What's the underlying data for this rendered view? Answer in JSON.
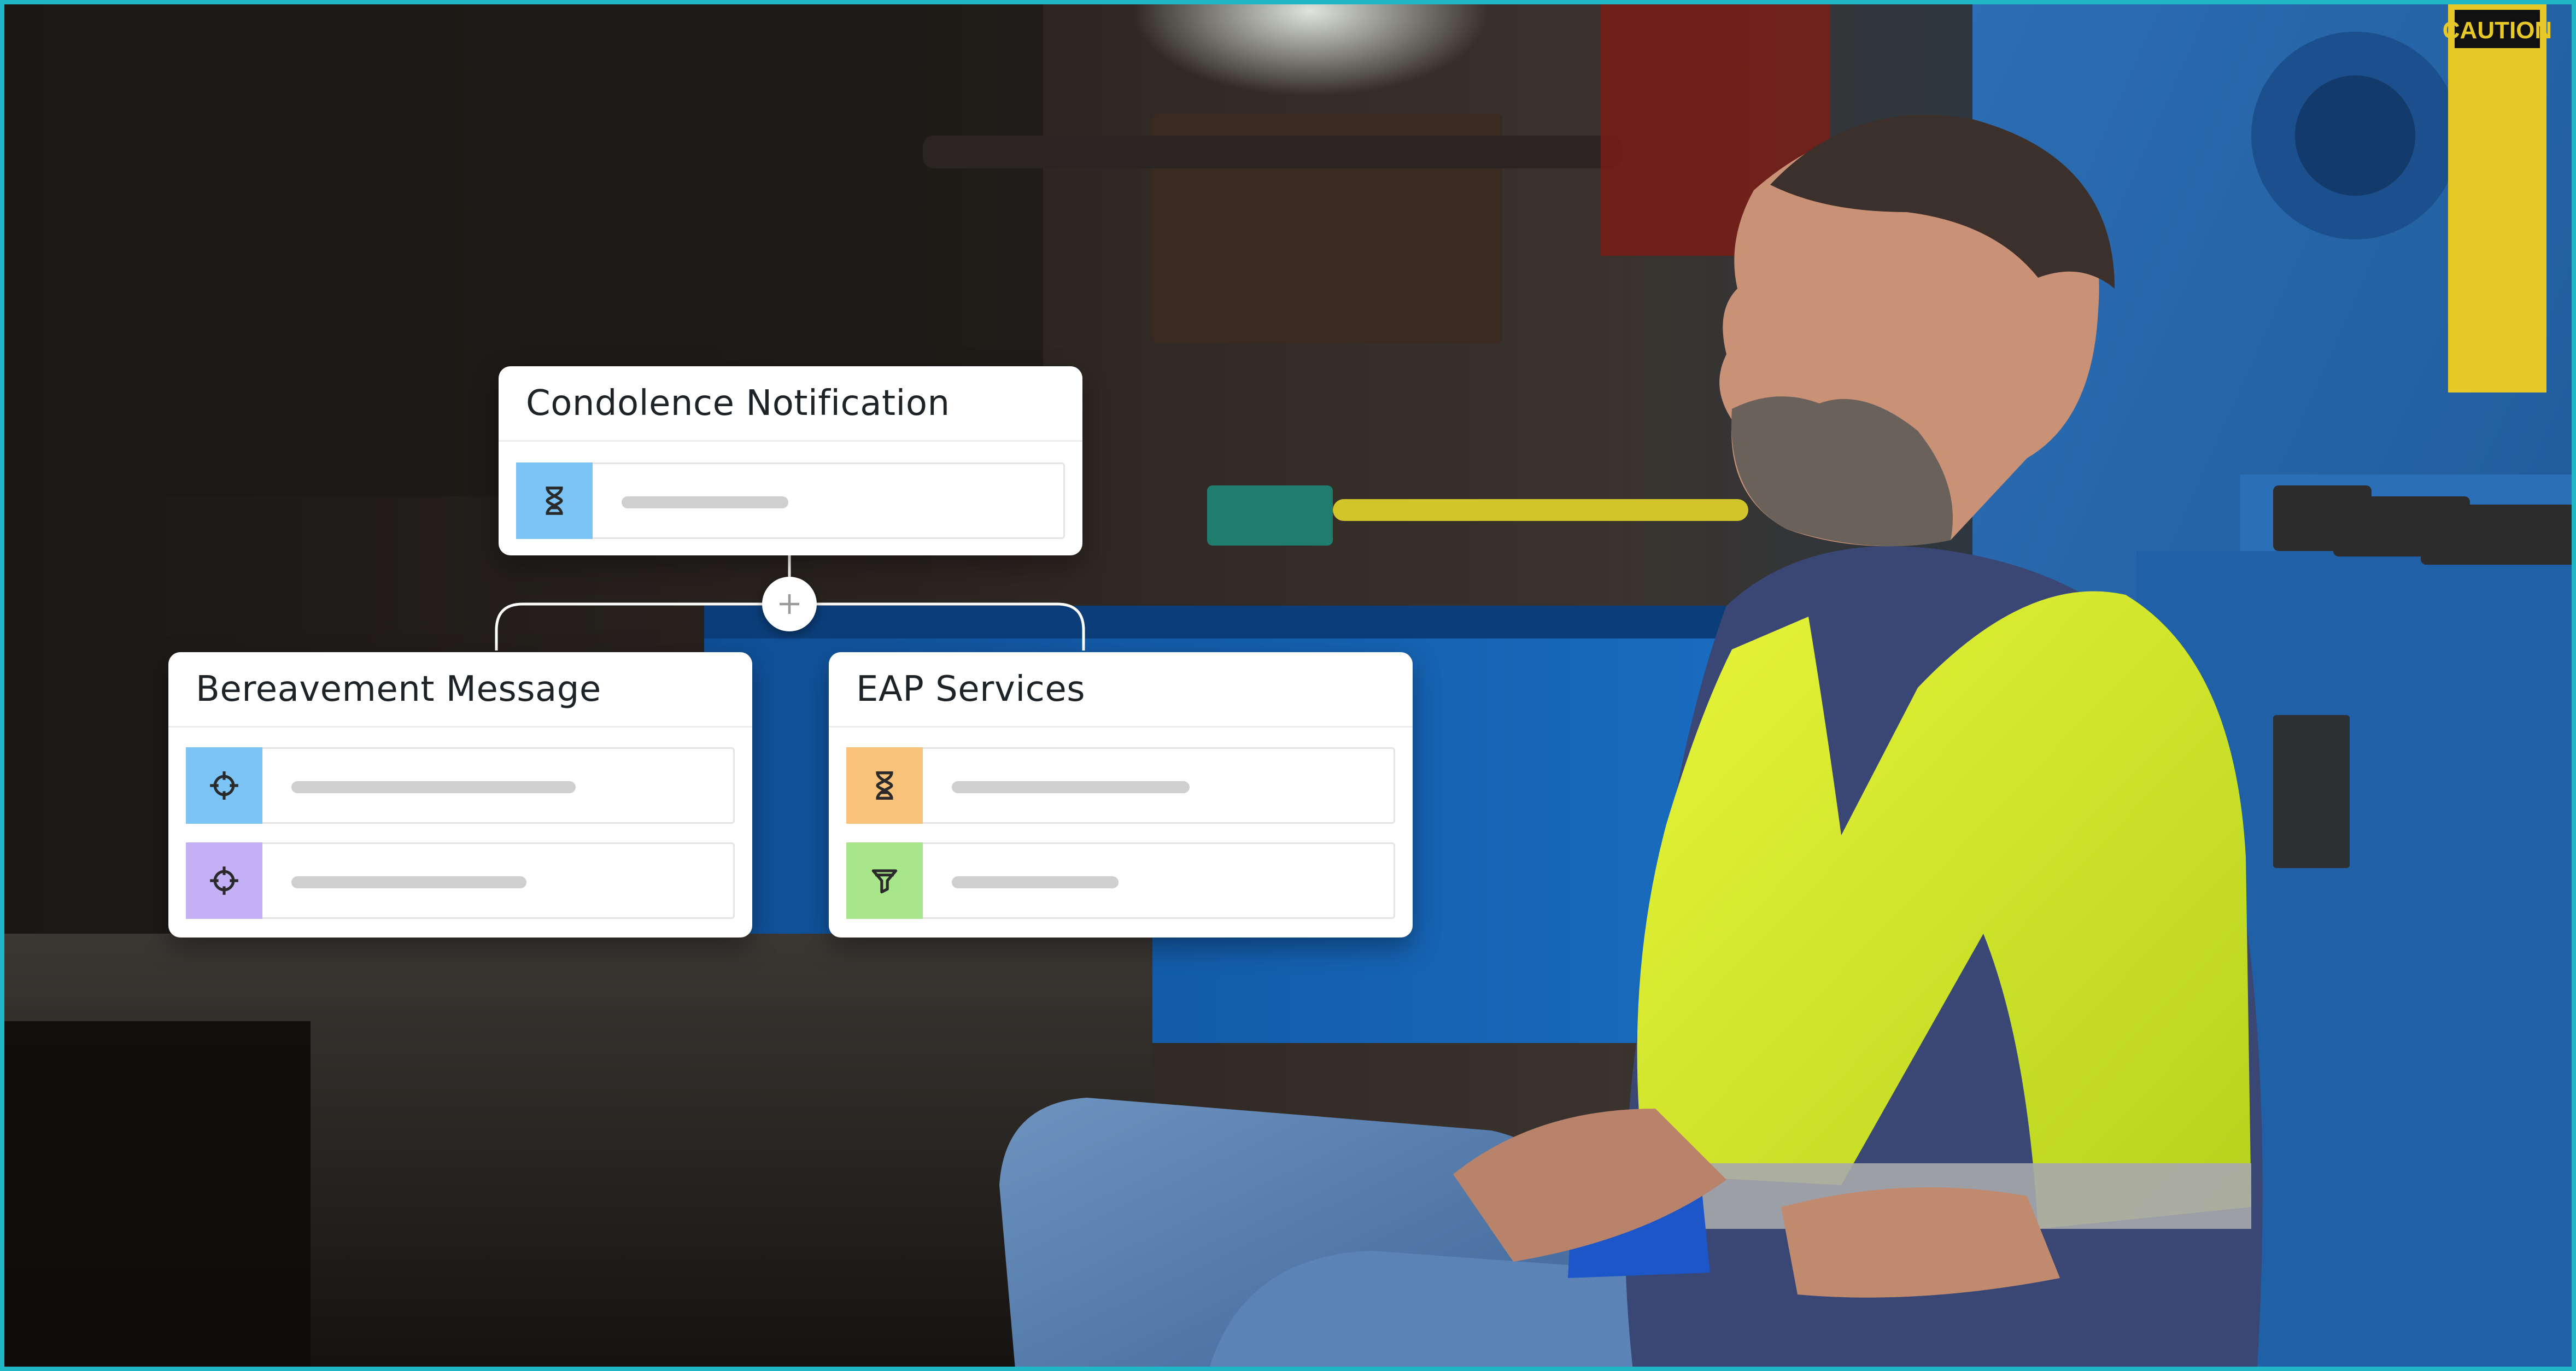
{
  "cards": {
    "condolence": {
      "title": "Condolence Notification",
      "rows": [
        {
          "icon": "hourglass-icon",
          "color": "#7cc4f6"
        }
      ]
    },
    "bereavement": {
      "title": "Bereavement Message",
      "rows": [
        {
          "icon": "crosshair-icon",
          "color": "#7cc4f6"
        },
        {
          "icon": "crosshair-icon",
          "color": "#c3b0f5"
        }
      ]
    },
    "eap": {
      "title": "EAP Services",
      "rows": [
        {
          "icon": "hourglass-icon",
          "color": "#f8c27a"
        },
        {
          "icon": "filter-icon",
          "color": "#a9e58a"
        }
      ]
    }
  },
  "add_button": {
    "icon": "plus-icon"
  },
  "background": {
    "description_icon": "factory-worker-photo",
    "sign": "CAUTION"
  },
  "colors": {
    "frame": "#1fb6c7"
  }
}
